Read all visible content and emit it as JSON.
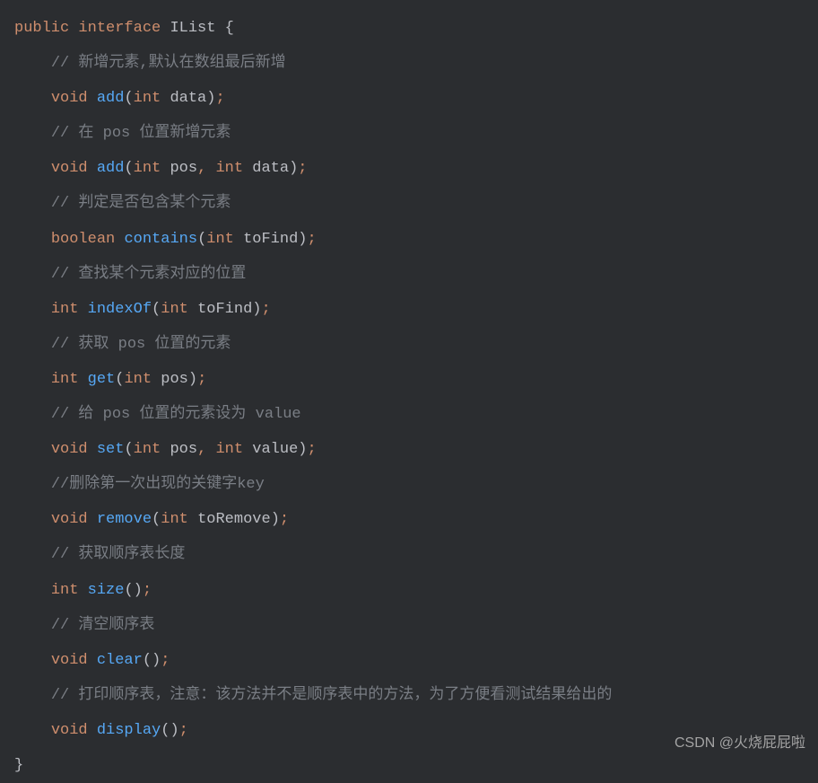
{
  "code": {
    "line1_public": "public",
    "line1_interface": "interface",
    "line1_name": "IList",
    "line1_brace": "{",
    "line2_comment": "// 新增元素,默认在数组最后新增",
    "line3_void": "void",
    "line3_method": "add",
    "line3_paren_open": "(",
    "line3_int": "int",
    "line3_param": "data",
    "line3_paren_close": ")",
    "line3_semi": ";",
    "line4_comment": "// 在 pos 位置新增元素",
    "line5_void": "void",
    "line5_method": "add",
    "line5_paren_open": "(",
    "line5_int1": "int",
    "line5_param1": "pos",
    "line5_comma": ",",
    "line5_int2": "int",
    "line5_param2": "data",
    "line5_paren_close": ")",
    "line5_semi": ";",
    "line6_comment": "// 判定是否包含某个元素",
    "line7_boolean": "boolean",
    "line7_method": "contains",
    "line7_paren_open": "(",
    "line7_int": "int",
    "line7_param": "toFind",
    "line7_paren_close": ")",
    "line7_semi": ";",
    "line8_comment": "// 查找某个元素对应的位置",
    "line9_int": "int",
    "line9_method": "indexOf",
    "line9_paren_open": "(",
    "line9_int2": "int",
    "line9_param": "toFind",
    "line9_paren_close": ")",
    "line9_semi": ";",
    "line10_comment": "// 获取 pos 位置的元素",
    "line11_int": "int",
    "line11_method": "get",
    "line11_paren_open": "(",
    "line11_int2": "int",
    "line11_param": "pos",
    "line11_paren_close": ")",
    "line11_semi": ";",
    "line12_comment": "// 给 pos 位置的元素设为 value",
    "line13_void": "void",
    "line13_method": "set",
    "line13_paren_open": "(",
    "line13_int1": "int",
    "line13_param1": "pos",
    "line13_comma": ",",
    "line13_int2": "int",
    "line13_param2": "value",
    "line13_paren_close": ")",
    "line13_semi": ";",
    "line14_comment": "//删除第一次出现的关键字key",
    "line15_void": "void",
    "line15_method": "remove",
    "line15_paren_open": "(",
    "line15_int": "int",
    "line15_param": "toRemove",
    "line15_paren_close": ")",
    "line15_semi": ";",
    "line16_comment": "// 获取顺序表长度",
    "line17_int": "int",
    "line17_method": "size",
    "line17_paren_open": "(",
    "line17_paren_close": ")",
    "line17_semi": ";",
    "line18_comment": "// 清空顺序表",
    "line19_void": "void",
    "line19_method": "clear",
    "line19_paren_open": "(",
    "line19_paren_close": ")",
    "line19_semi": ";",
    "line20_comment": "// 打印顺序表，注意：该方法并不是顺序表中的方法，为了方便看测试结果给出的",
    "line21_void": "void",
    "line21_method": "display",
    "line21_paren_open": "(",
    "line21_paren_close": ")",
    "line21_semi": ";",
    "line22_brace": "}"
  },
  "watermark": "CSDN @火烧屁屁啦"
}
